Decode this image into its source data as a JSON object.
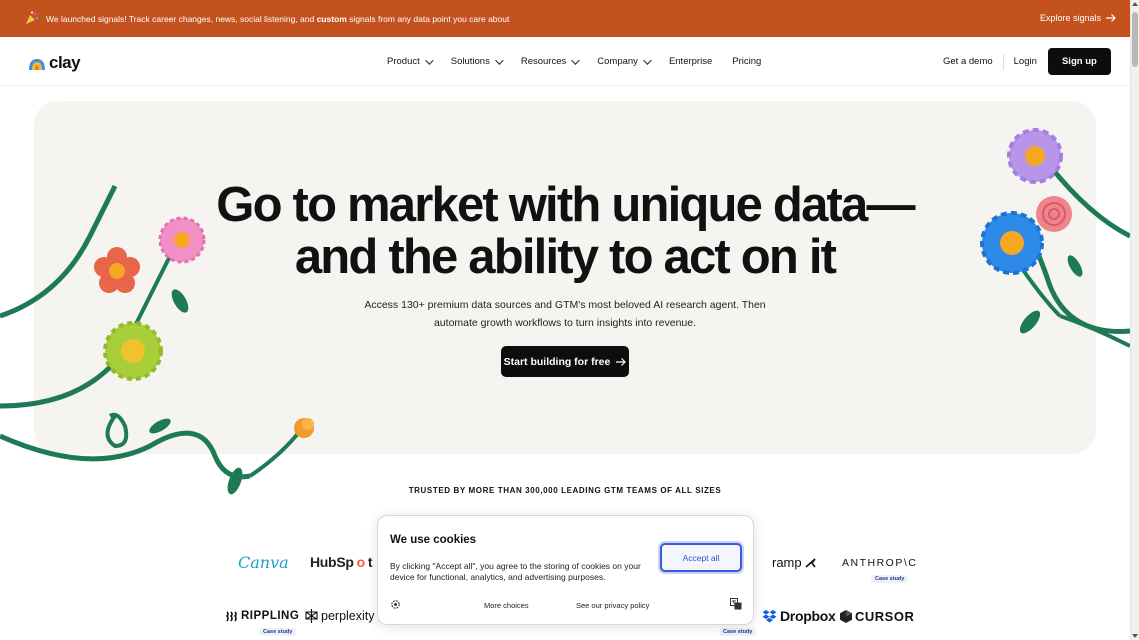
{
  "announcement": {
    "text_before": "We launched signals! Track career changes, news, social listening, and ",
    "text_bold": "custom",
    "text_after": " signals from any data point you care about",
    "link_label": "Explore signals"
  },
  "nav": {
    "brand": "clay",
    "menu": [
      {
        "label": "Product",
        "has_dropdown": true
      },
      {
        "label": "Solutions",
        "has_dropdown": true
      },
      {
        "label": "Resources",
        "has_dropdown": true
      },
      {
        "label": "Company",
        "has_dropdown": true
      },
      {
        "label": "Enterprise",
        "has_dropdown": false
      },
      {
        "label": "Pricing",
        "has_dropdown": false
      }
    ],
    "demo_label": "Get a demo",
    "login_label": "Login",
    "signup_label": "Sign up"
  },
  "hero": {
    "headline_line1": "Go to market with unique data—",
    "headline_line2": "and the ability to act on it",
    "subtitle_line1": "Access 130+ premium data sources and GTM's most beloved AI research agent. Then",
    "subtitle_line2": "automate growth workflows to turn insights into revenue.",
    "cta_label": "Start building for free"
  },
  "trusted": {
    "heading": "TRUSTED BY MORE THAN 300,000 LEADING GTM TEAMS OF ALL SIZES"
  },
  "logos": {
    "canva": "Canva",
    "hubspot_pre": "HubSp",
    "hubspot_o": "o",
    "hubspot_post": "t",
    "ramp": "ramp",
    "anthropic": "ANTHROP\\C",
    "rippling": "RIPPLING",
    "perplexity": "perplexity",
    "dropbox": "Dropbox",
    "cursor": "CURSOR",
    "case_study_label": "Case study"
  },
  "cookie": {
    "title": "We use cookies",
    "body": "By clicking \"Accept all\", you agree to the storing of cookies on your device for functional, analytics, and advertising purposes.",
    "accept_label": "Accept all",
    "more_label": "More choices",
    "policy_label": "See our privacy policy"
  },
  "colors": {
    "announcement_bg": "#c3521f",
    "hero_bg": "#f5f4f1",
    "button_dark": "#0d0d0d",
    "accept_blue": "#2d4ed1"
  }
}
